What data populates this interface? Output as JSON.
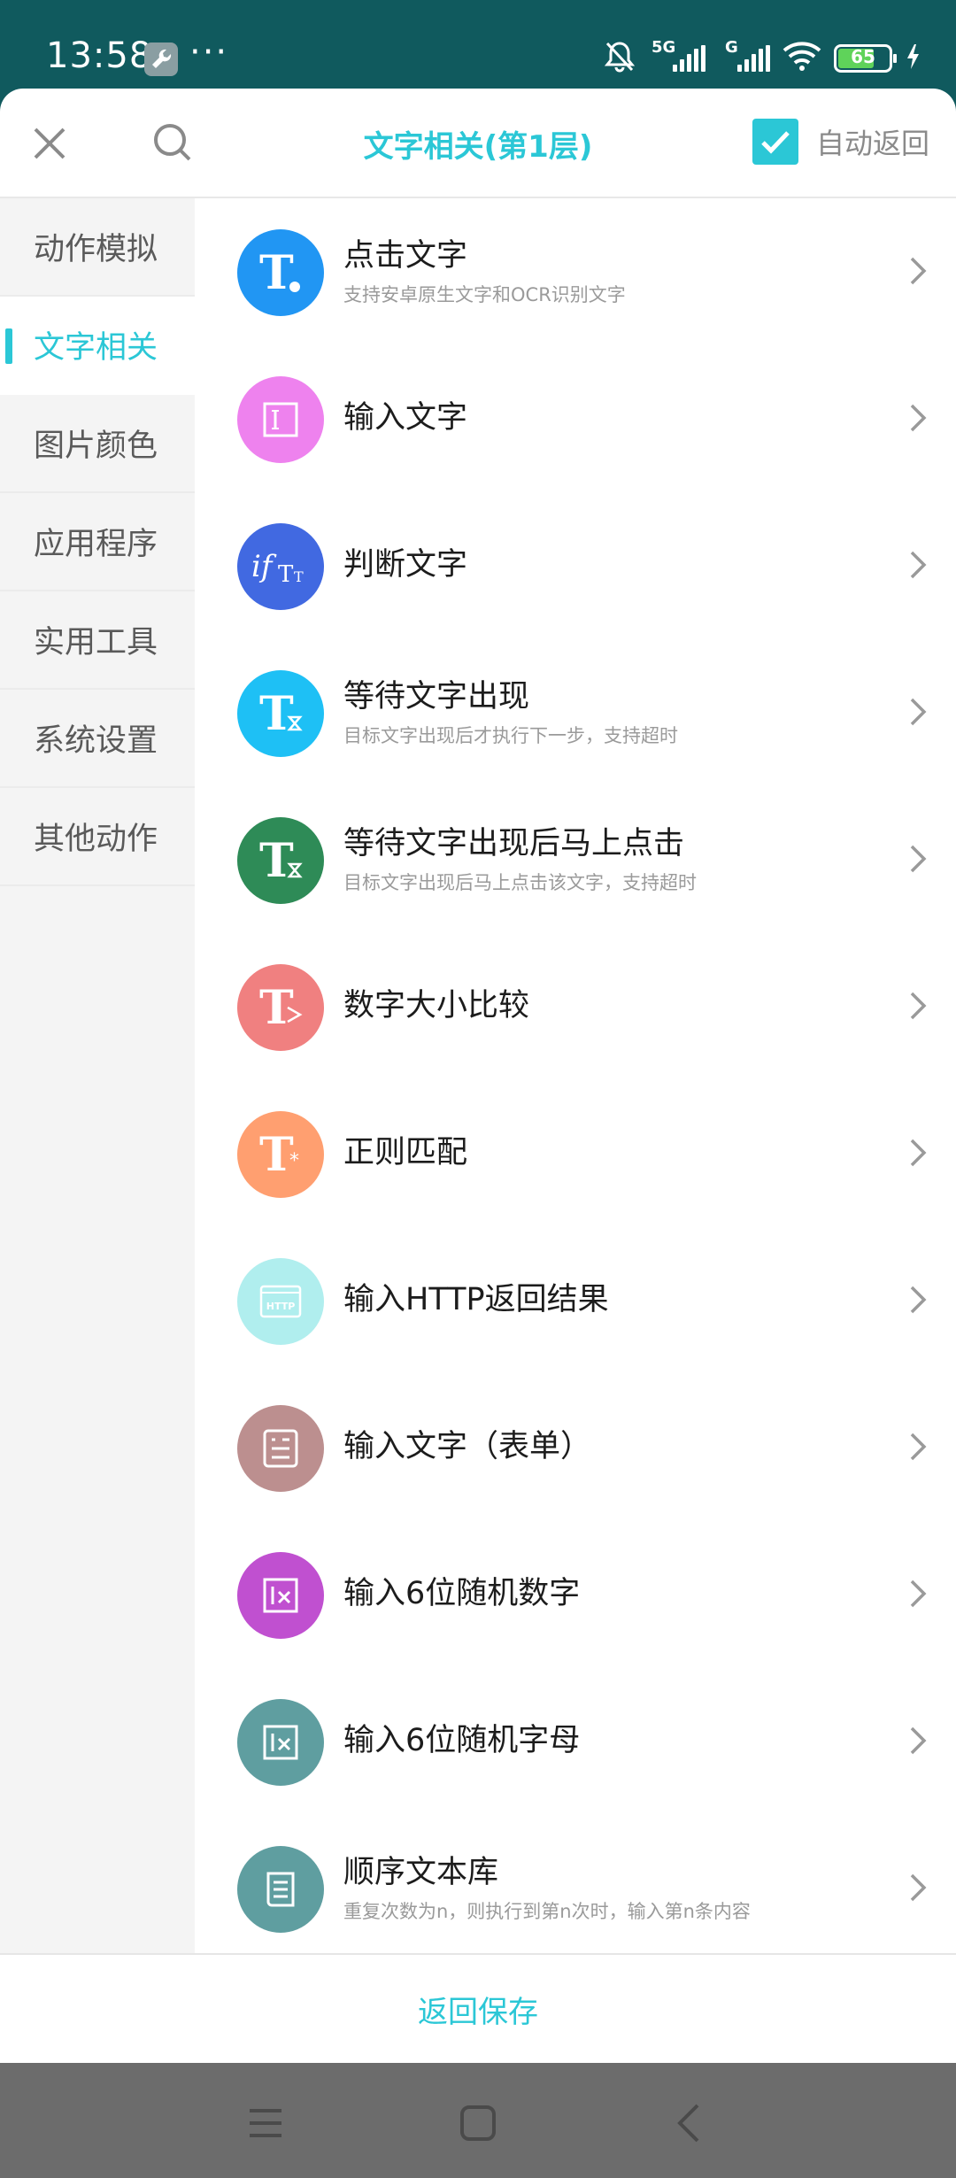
{
  "status_bar": {
    "time": "13:58",
    "more": "···",
    "battery": "65",
    "signal1_tag": "5G",
    "signal2_tag": "G"
  },
  "header": {
    "title": "文字相关(第1层)",
    "auto_return_label": "自动返回",
    "auto_return_checked": true
  },
  "sidebar": {
    "items": [
      {
        "label": "动作模拟",
        "active": false
      },
      {
        "label": "文字相关",
        "active": true
      },
      {
        "label": "图片颜色",
        "active": false
      },
      {
        "label": "应用程序",
        "active": false
      },
      {
        "label": "实用工具",
        "active": false
      },
      {
        "label": "系统设置",
        "active": false
      },
      {
        "label": "其他动作",
        "active": false
      }
    ]
  },
  "actions": [
    {
      "name": "点击文字",
      "sub": "支持安卓原生文字和OCR识别文字",
      "icon": "text-click-icon",
      "color": "#2196f3"
    },
    {
      "name": "输入文字",
      "sub": "",
      "icon": "text-input-icon",
      "color": "#ee82ee"
    },
    {
      "name": "判断文字",
      "sub": "",
      "icon": "if-text-icon",
      "color": "#4169e1"
    },
    {
      "name": "等待文字出现",
      "sub": "目标文字出现后才执行下一步，支持超时",
      "icon": "text-wait-icon",
      "color": "#1ec0f5"
    },
    {
      "name": "等待文字出现后马上点击",
      "sub": "目标文字出现后马上点击该文字，支持超时",
      "icon": "text-wait-click-icon",
      "color": "#2e8b57"
    },
    {
      "name": "数字大小比较",
      "sub": "",
      "icon": "number-compare-icon",
      "color": "#f08080"
    },
    {
      "name": "正则匹配",
      "sub": "",
      "icon": "regex-icon",
      "color": "#ff9f70"
    },
    {
      "name": "输入HTTP返回结果",
      "sub": "",
      "icon": "http-icon",
      "color": "#b0eeee"
    },
    {
      "name": "输入文字（表单）",
      "sub": "",
      "icon": "form-icon",
      "color": "#bc8f8f"
    },
    {
      "name": "输入6位随机数字",
      "sub": "",
      "icon": "random-digits-icon",
      "color": "#c050d0"
    },
    {
      "name": "输入6位随机字母",
      "sub": "",
      "icon": "random-letters-icon",
      "color": "#5f9ea0"
    },
    {
      "name": "顺序文本库",
      "sub": "重复次数为n，则执行到第n次时，输入第n条内容",
      "icon": "text-library-icon",
      "color": "#5f9ea0"
    }
  ],
  "footer": {
    "save_label": "返回保存"
  }
}
